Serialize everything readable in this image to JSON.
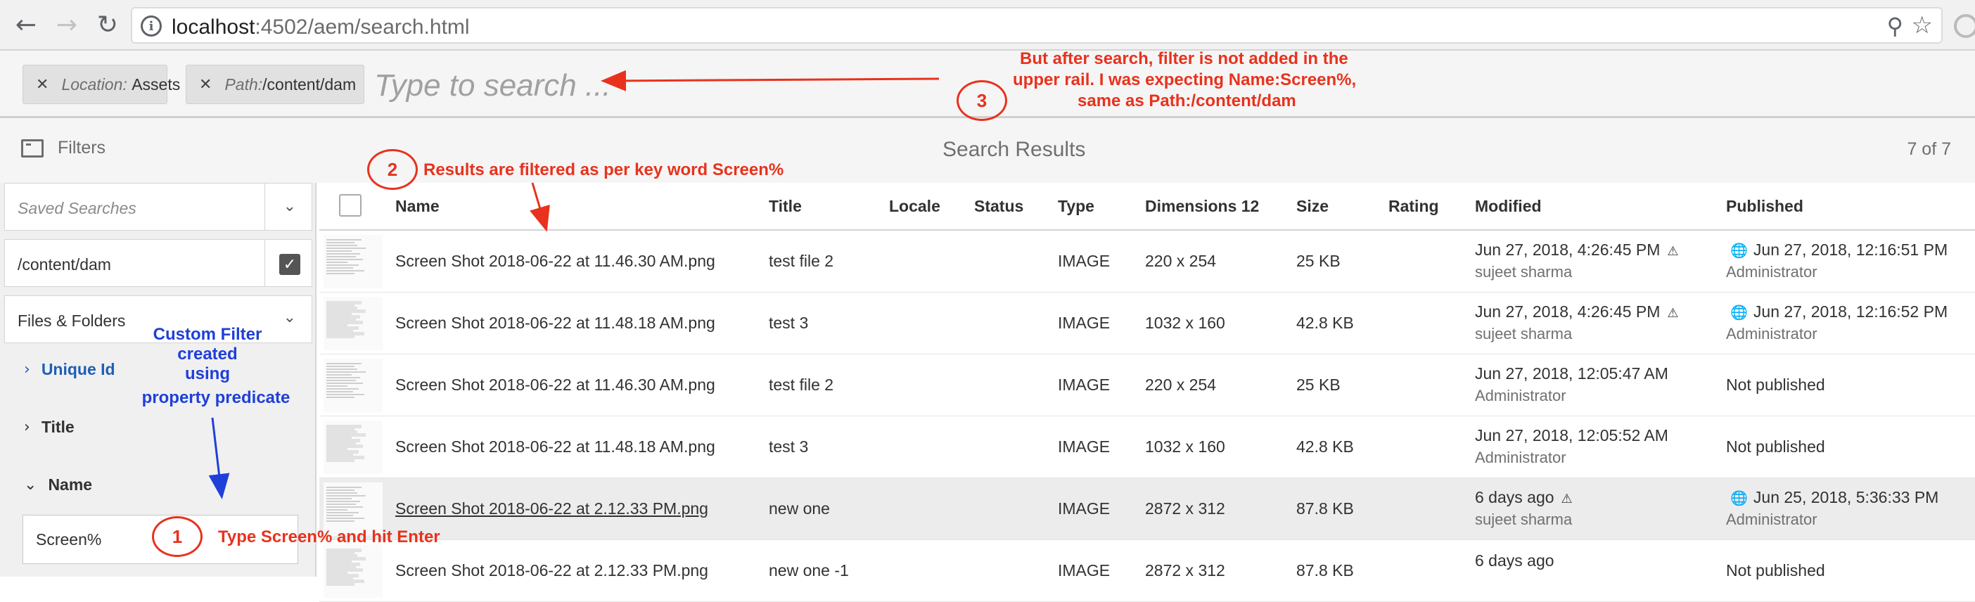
{
  "browser": {
    "url_host": "localhost",
    "url_rest": ":4502/aem/search.html",
    "icons": [
      "back-icon",
      "forward-icon",
      "reload-icon",
      "info-icon",
      "zoom-icon",
      "star-icon"
    ]
  },
  "omnisearch": {
    "tags": [
      {
        "label": "Location:",
        "value": "Assets"
      },
      {
        "label": "Path:",
        "value": "/content/dam"
      }
    ],
    "placeholder": "Type to search ..."
  },
  "header": {
    "filters_label": "Filters",
    "title": "Search Results",
    "count": "7 of 7"
  },
  "rail": {
    "saved_searches_placeholder": "Saved Searches",
    "path_value": "/content/dam",
    "scope_value": "Files & Folders",
    "facets": [
      "Unique Id",
      "Title",
      "Name"
    ],
    "name_value": "Screen%"
  },
  "table": {
    "columns": [
      "Name",
      "Title",
      "Locale",
      "Status",
      "Type",
      "Dimensions 12",
      "Size",
      "Rating",
      "Modified",
      "Published"
    ],
    "rows": [
      {
        "name": "Screen Shot 2018-06-22 at 11.46.30 AM.png",
        "title": "test file 2",
        "type": "IMAGE",
        "dimensions": "220 x 254",
        "size": "25 KB",
        "modified": "Jun 27, 2018, 4:26:45 PM",
        "modified_warn": true,
        "modified_by": "sujeet sharma",
        "published": "Jun 27, 2018, 12:16:51 PM",
        "published_globe": true,
        "published_by": "Administrator"
      },
      {
        "name": "Screen Shot 2018-06-22 at 11.48.18 AM.png",
        "title": "test 3",
        "type": "IMAGE",
        "dimensions": "1032 x 160",
        "size": "42.8 KB",
        "modified": "Jun 27, 2018, 4:26:45 PM",
        "modified_warn": true,
        "modified_by": "sujeet sharma",
        "published": "Jun 27, 2018, 12:16:52 PM",
        "published_globe": true,
        "published_by": "Administrator"
      },
      {
        "name": "Screen Shot 2018-06-22 at 11.46.30 AM.png",
        "title": "test file 2",
        "type": "IMAGE",
        "dimensions": "220 x 254",
        "size": "25 KB",
        "modified": "Jun 27, 2018, 12:05:47 AM",
        "modified_warn": false,
        "modified_by": "Administrator",
        "published": "Not published",
        "published_globe": false,
        "published_by": ""
      },
      {
        "name": "Screen Shot 2018-06-22 at 11.48.18 AM.png",
        "title": "test 3",
        "type": "IMAGE",
        "dimensions": "1032 x 160",
        "size": "42.8 KB",
        "modified": "Jun 27, 2018, 12:05:52 AM",
        "modified_warn": false,
        "modified_by": "Administrator",
        "published": "Not published",
        "published_globe": false,
        "published_by": ""
      },
      {
        "name": "Screen Shot 2018-06-22 at 2.12.33 PM.png",
        "title": "new one",
        "type": "IMAGE",
        "dimensions": "2872 x 312",
        "size": "87.8 KB",
        "modified": "6 days ago",
        "modified_warn": true,
        "modified_by": "sujeet sharma",
        "published": "Jun 25, 2018, 5:36:33 PM",
        "published_globe": true,
        "published_by": "Administrator"
      },
      {
        "name": "Screen Shot 2018-06-22 at 2.12.33 PM.png",
        "title": "new one -1",
        "type": "IMAGE",
        "dimensions": "2872 x 312",
        "size": "87.8 KB",
        "modified": "6 days ago",
        "modified_warn": false,
        "modified_by": "",
        "published": "Not published",
        "published_globe": false,
        "published_by": ""
      }
    ]
  },
  "annotations": {
    "note3_line1": "But after search, filter is not added in the",
    "note3_line2": "upper rail. I was expecting Name:Screen%,",
    "note3_line3": "same as Path:/content/dam",
    "num1": "1",
    "num2": "2",
    "num3": "3",
    "note2": "Results are filtered as per key word Screen%",
    "note1": "Type Screen% and hit Enter",
    "custom_line1": "Custom Filter",
    "custom_line2": "created",
    "custom_line3": "using",
    "custom_line4": "property predicate",
    "colors": {
      "red": "#e8321d",
      "blue": "#1f3fd9"
    }
  }
}
